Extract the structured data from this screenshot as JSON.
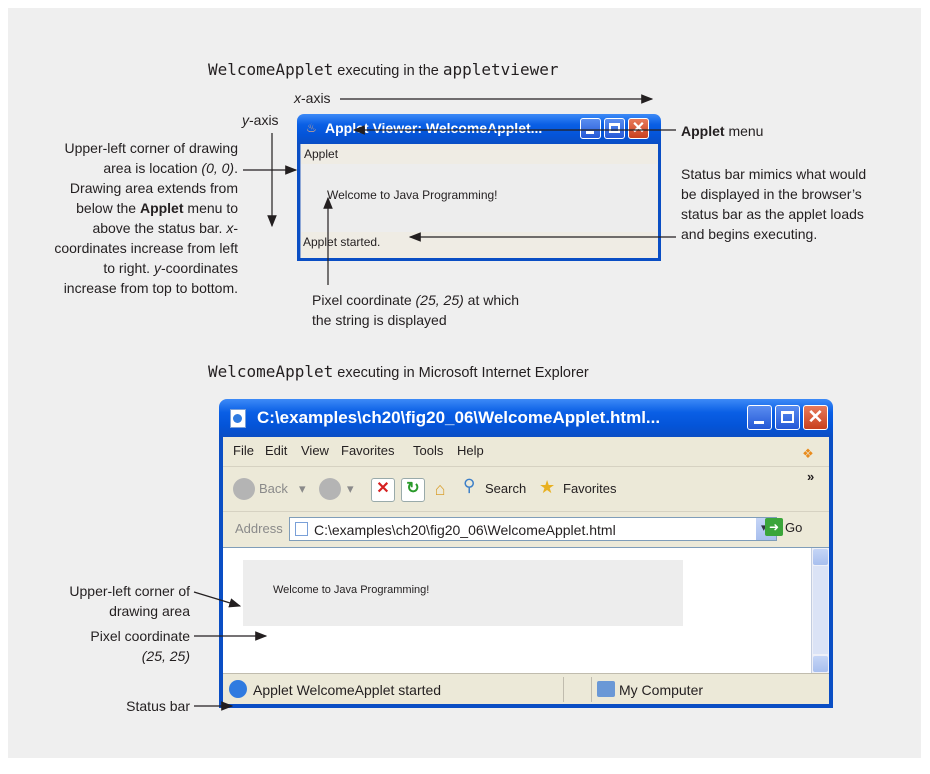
{
  "top_caption": {
    "code": "WelcomeApplet",
    "mid": " executing in the ",
    "code2": "appletviewer"
  },
  "bottom_caption": {
    "code": "WelcomeApplet",
    "rest": " executing in Microsoft Internet Explorer"
  },
  "axes": {
    "x_prefix": "x",
    "x_suffix": "-axis",
    "y_prefix": "y",
    "y_suffix": "-axis"
  },
  "viewer": {
    "title": "Applet Viewer: WelcomeApplet...",
    "menu": "Applet",
    "message": "Welcome to Java Programming!",
    "status": "Applet started."
  },
  "callouts_top": {
    "upper_left_l1": "Upper-left corner of drawing",
    "upper_left_l2a": "area is location ",
    "upper_left_l2b": "(0, 0)",
    "upper_left_l2c": ".",
    "upper_left_l3": "Drawing area extends from",
    "upper_left_l4a": "below the ",
    "upper_left_l4b": "Applet",
    "upper_left_l4c": " menu to",
    "upper_left_l5a": "above the status bar. ",
    "upper_left_l5b": "x",
    "upper_left_l5c": "-",
    "upper_left_l6": "coordinates increase from left",
    "upper_left_l7a": "to right. ",
    "upper_left_l7b": "y",
    "upper_left_l7c": "-coordinates",
    "upper_left_l8": "increase from top to bottom.",
    "applet_menu_bold": "Applet",
    "applet_menu_rest": " menu",
    "status_l1": "Status bar mimics what would",
    "status_l2": "be displayed in the browser’s",
    "status_l3": "status bar as the applet loads",
    "status_l4": "and begins executing.",
    "pixel_l1a": "Pixel coordinate ",
    "pixel_l1b": "(25, 25)",
    "pixel_l1c": " at which",
    "pixel_l2": "the string is displayed"
  },
  "callouts_bottom": {
    "upper_left_l1": "Upper-left corner of",
    "upper_left_l2": "drawing area",
    "pixel_l1": "Pixel coordinate",
    "pixel_l2": "(25, 25)",
    "status": "Status bar"
  },
  "ie": {
    "title": "C:\\examples\\ch20\\fig20_06\\WelcomeApplet.html...",
    "menu": [
      "File",
      "Edit",
      "View",
      "Favorites",
      "Tools",
      "Help"
    ],
    "toolbar": {
      "back": "Back",
      "search": "Search",
      "favorites": "Favorites",
      "more": "»"
    },
    "address_label": "Address",
    "address": "C:\\examples\\ch20\\fig20_06\\WelcomeApplet.html",
    "go": "Go",
    "message": "Welcome to Java Programming!",
    "status": "Applet WelcomeApplet started",
    "zone": "My Computer"
  }
}
